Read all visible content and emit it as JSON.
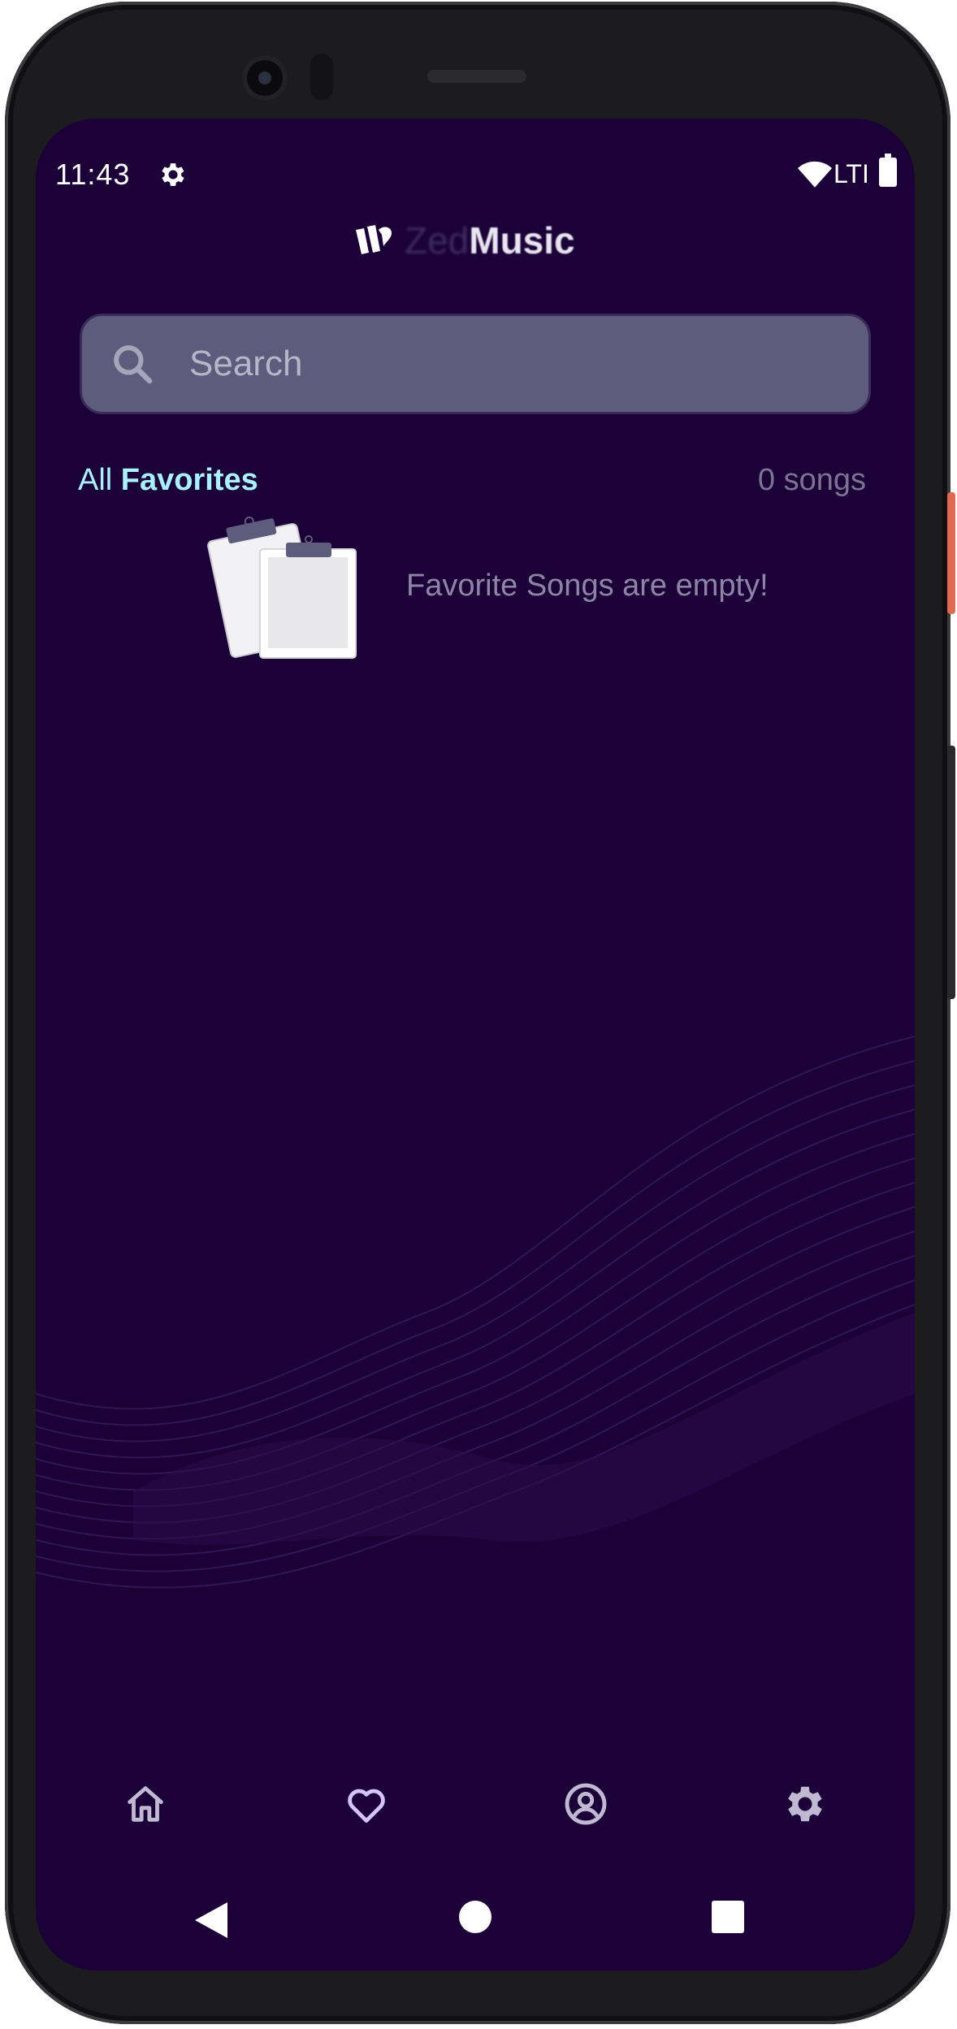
{
  "status_bar": {
    "time": "11:43",
    "signal": "LTI",
    "icons": [
      "settings-icon",
      "wifi-icon",
      "battery-icon"
    ]
  },
  "app": {
    "logo_part1": "Zed",
    "logo_part2": "Music"
  },
  "search": {
    "placeholder": "Search"
  },
  "favorites": {
    "heading_prefix": "All",
    "heading_strong": "Favorites",
    "count": "0 songs",
    "empty_message": "Favorite Songs are empty!"
  },
  "bottom_nav": {
    "items": [
      {
        "icon": "home-icon"
      },
      {
        "icon": "heart-icon"
      },
      {
        "icon": "account-icon"
      },
      {
        "icon": "settings-icon"
      }
    ]
  },
  "system_nav": {
    "icons": [
      "back-icon",
      "home-circle-icon",
      "recents-icon"
    ]
  },
  "colors": {
    "background": "#1c0038",
    "search_bg": "#5d5c7c",
    "accent": "#a8f1ff",
    "muted_text": "#8d85a6",
    "nav_icon": "#bfb9d2",
    "nav_icon_active": "#d6c3f7"
  }
}
